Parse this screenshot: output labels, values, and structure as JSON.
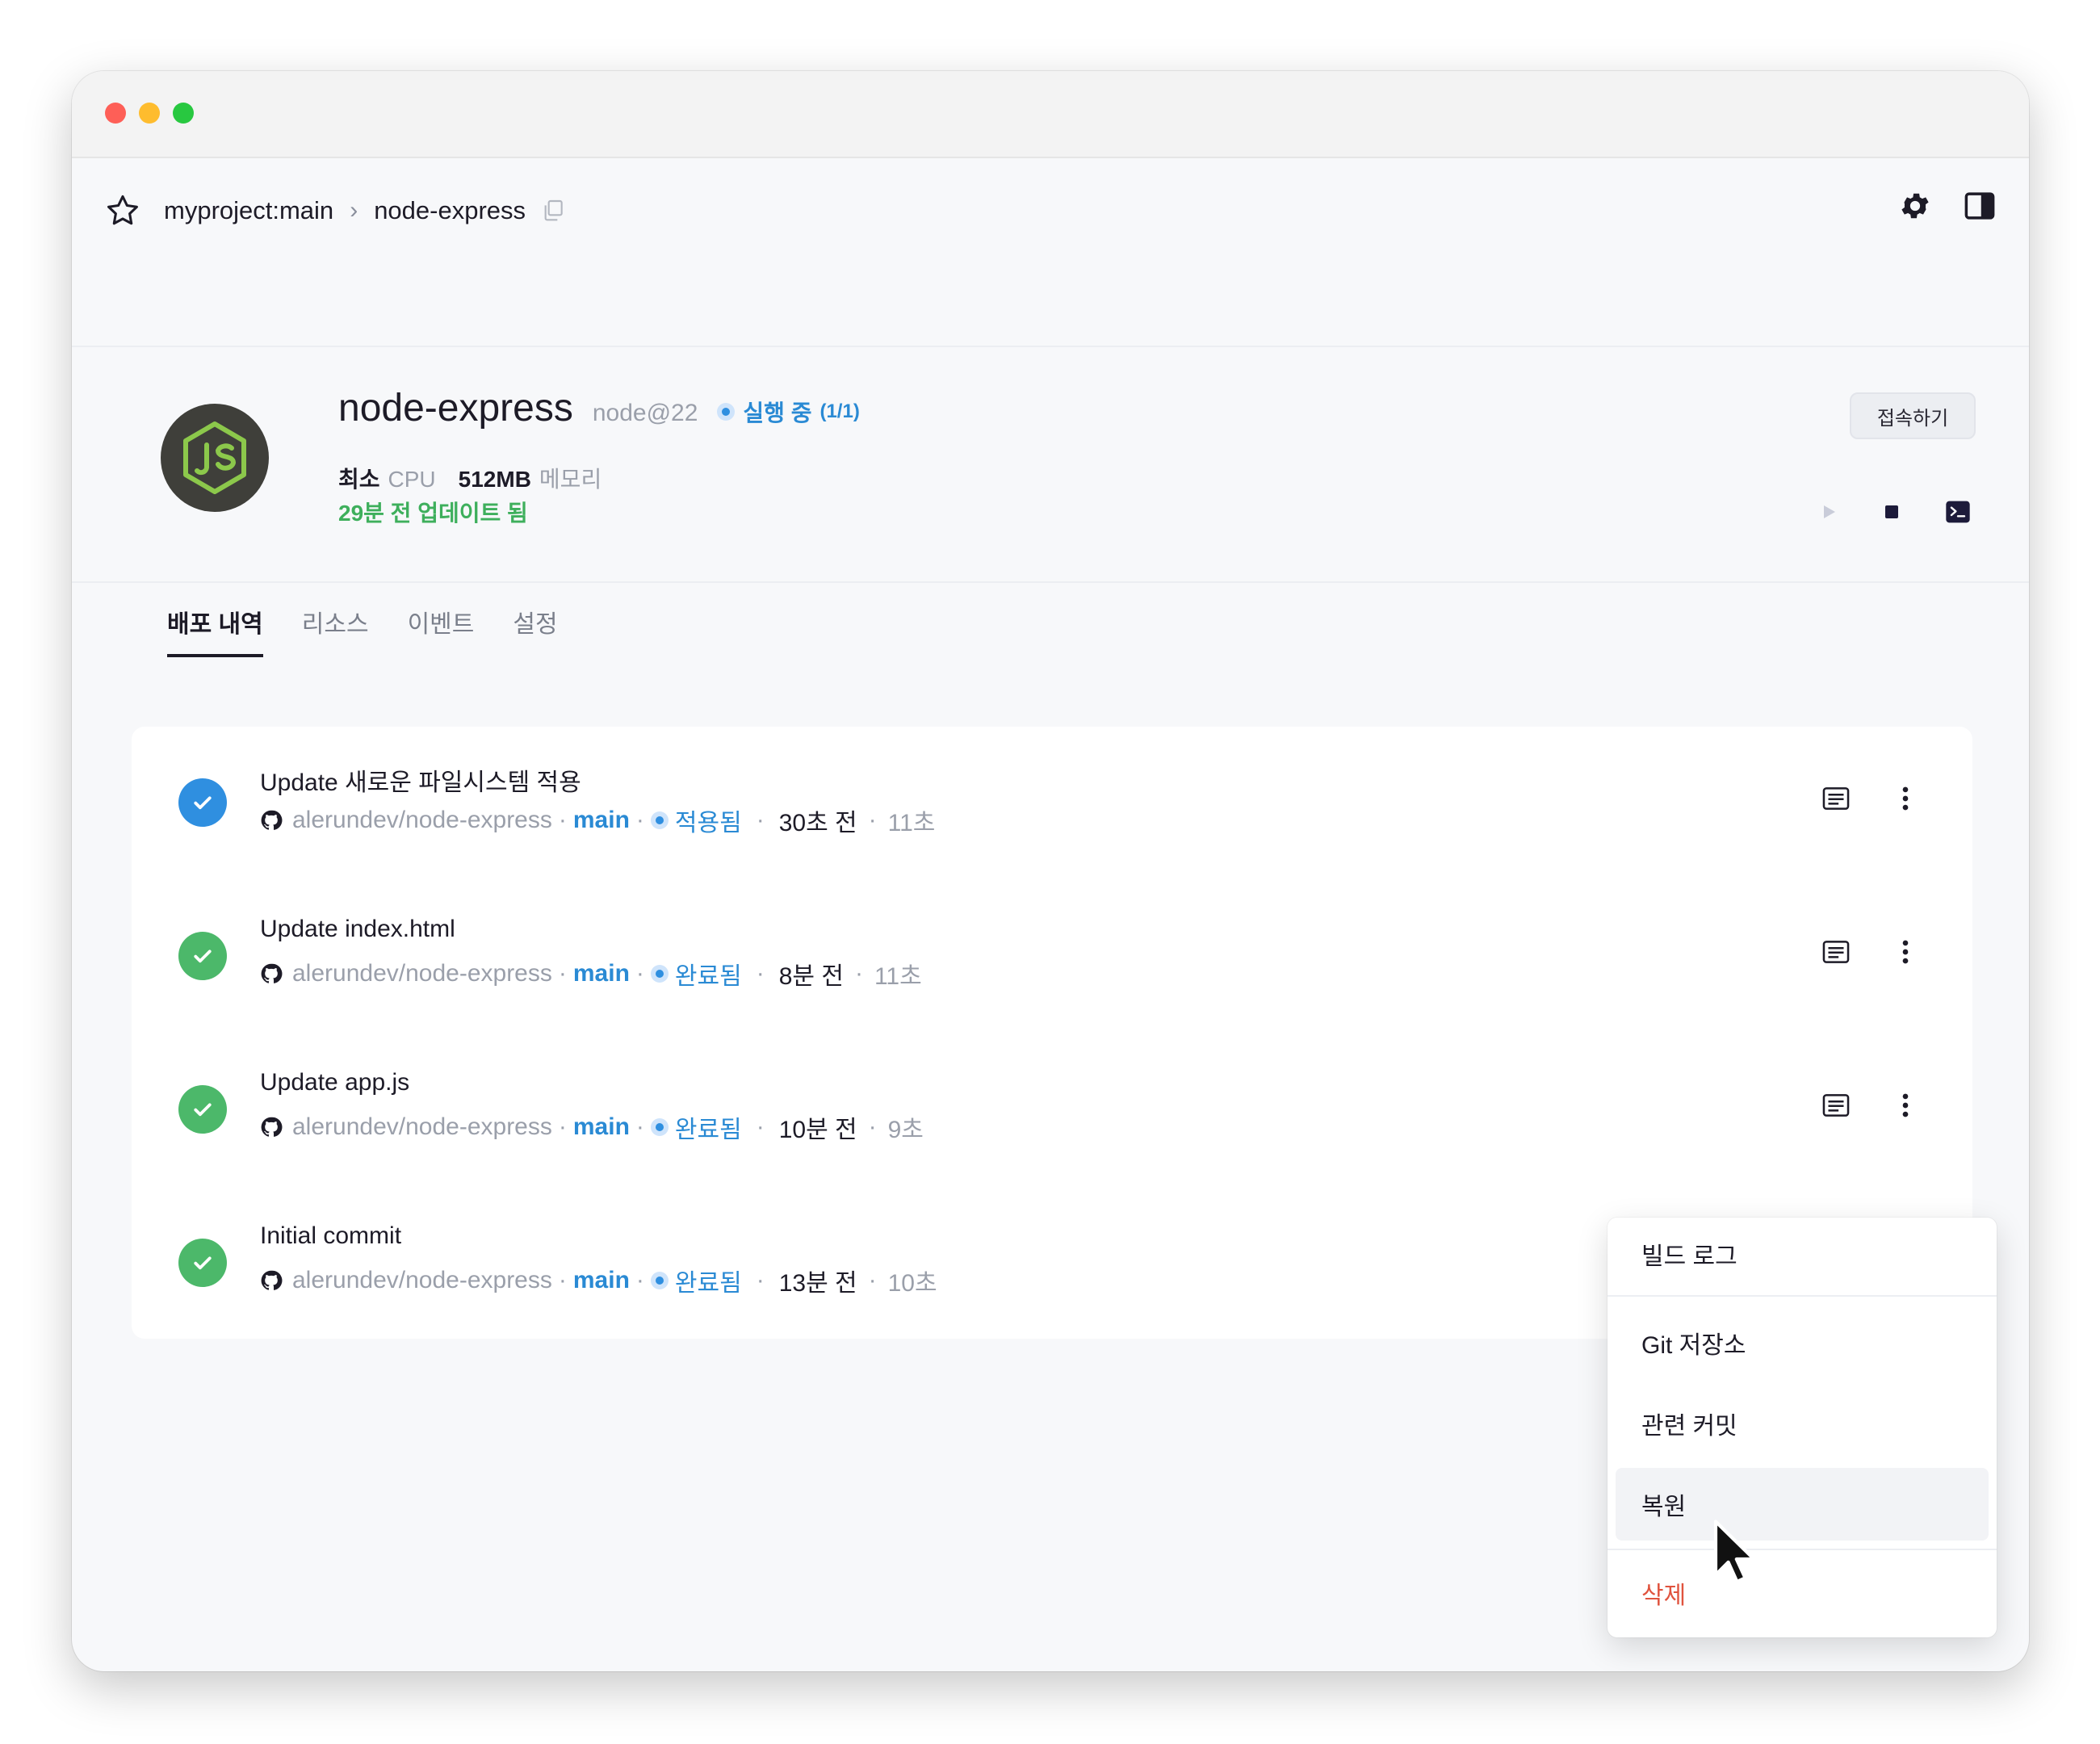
{
  "breadcrumb": {
    "project": "myproject:main",
    "separator": "›",
    "service": "node-express"
  },
  "service": {
    "name": "node-express",
    "runtime": "node@22",
    "status_label": "실행 중",
    "status_count": "(1/1)",
    "cpu_value": "최소",
    "cpu_label": "CPU",
    "memory_value": "512MB",
    "memory_label": "메모리",
    "updated": "29분 전 업데이트 됨",
    "connect_label": "접속하기"
  },
  "tabs": [
    {
      "label": "배포 내역",
      "active": true
    },
    {
      "label": "리소스",
      "active": false
    },
    {
      "label": "이벤트",
      "active": false
    },
    {
      "label": "설정",
      "active": false
    }
  ],
  "deployments": [
    {
      "title": "Update 새로운 파일시스템 적용",
      "repo": "alerundev/node-express",
      "branch": "main",
      "state": "적용됨",
      "time": "30초 전",
      "duration": "11초",
      "check_color": "#2f8fe0"
    },
    {
      "title": "Update index.html",
      "repo": "alerundev/node-express",
      "branch": "main",
      "state": "완료됨",
      "time": "8분 전",
      "duration": "11초",
      "check_color": "#4cb86a"
    },
    {
      "title": "Update app.js",
      "repo": "alerundev/node-express",
      "branch": "main",
      "state": "완료됨",
      "time": "10분 전",
      "duration": "9초",
      "check_color": "#4cb86a"
    },
    {
      "title": "Initial commit",
      "repo": "alerundev/node-express",
      "branch": "main",
      "state": "완료됨",
      "time": "13분 전",
      "duration": "10초",
      "check_color": "#4cb86a"
    }
  ],
  "meta_dot": "·",
  "context_menu": {
    "items": [
      {
        "label": "빌드 로그"
      },
      {
        "label": "Git 저장소"
      },
      {
        "label": "관련 커밋"
      },
      {
        "label": "복원",
        "hovered": true
      },
      {
        "label": "삭제",
        "danger": true
      }
    ]
  },
  "colors": {
    "accent_blue": "#2a8ad4",
    "success_green": "#4cb86a",
    "danger_red": "#e0533e",
    "traffic_red": "#fe5f57",
    "traffic_yellow": "#febc2e",
    "traffic_green": "#28c840"
  },
  "icons": {
    "star": "star-icon",
    "copy": "copy-icon",
    "settings": "gear-icon",
    "sidebar": "sidebar-toggle-icon",
    "play": "play-icon",
    "stop": "stop-icon",
    "terminal": "terminal-icon",
    "logs": "log-icon",
    "more": "more-vertical-icon",
    "github": "github-icon",
    "check": "check-icon",
    "cursor": "mouse-cursor-icon"
  }
}
